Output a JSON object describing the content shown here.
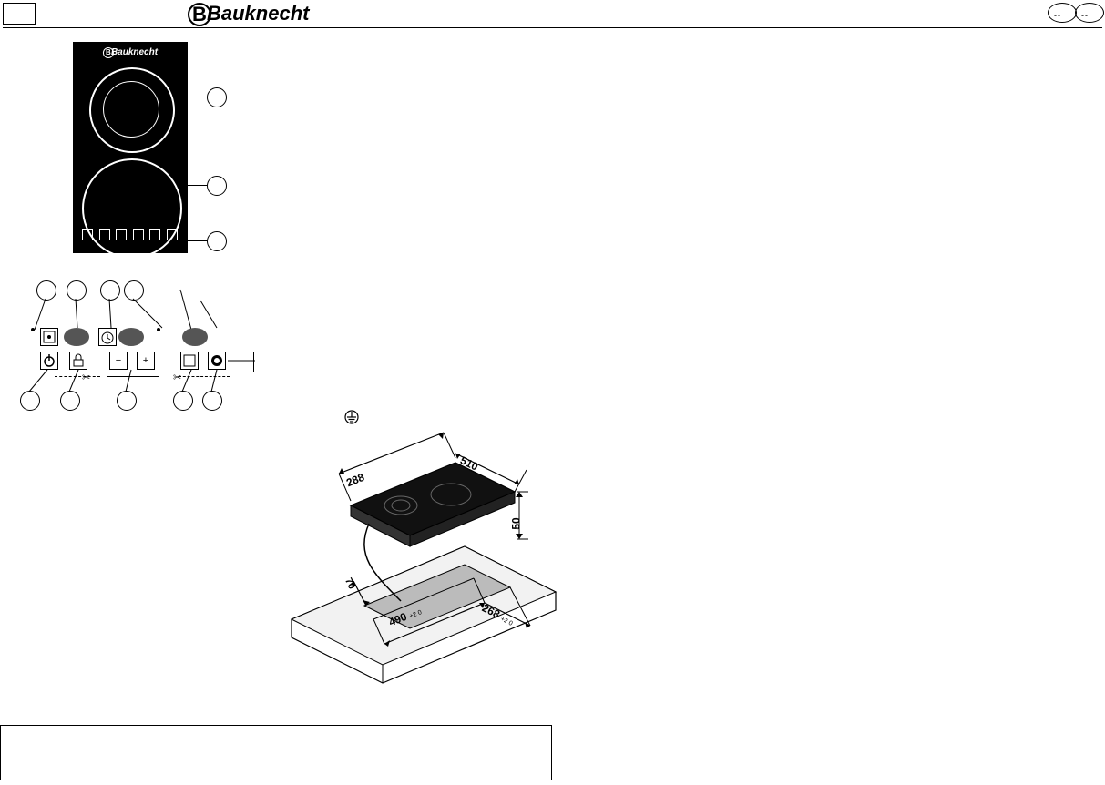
{
  "header": {
    "brand": "Bauknecht",
    "brand_initial": "B",
    "top_right_dash1": "--",
    "top_right_dash2": "--"
  },
  "callouts": {
    "hob_top": "",
    "hob_mid": "",
    "hob_bottom": "",
    "cp_1": "",
    "cp_2": "",
    "cp_3": "",
    "cp_4": "",
    "cp_b1": "",
    "cp_b2": "",
    "cp_b3": "",
    "cp_b4": "",
    "cp_b5": ""
  },
  "controlpanel": {
    "minus": "−",
    "plus": "+",
    "power_icon": "power-icon",
    "lock_icon": "lock-icon",
    "zone_icon": "zone-select-icon",
    "timer_icon": "timer-icon",
    "boost_icon": "boost-icon"
  },
  "dimensions": {
    "hob_width": "288",
    "hob_depth": "510",
    "hob_height": "50",
    "cutout_width": "490",
    "cutout_width_tol": "+2 0",
    "cutout_depth": "268",
    "cutout_depth_tol": "+2 0",
    "cutout_edge": "70"
  },
  "notebox": {
    "text": ""
  },
  "page": {
    "doc_type": "product-data-sheet"
  }
}
